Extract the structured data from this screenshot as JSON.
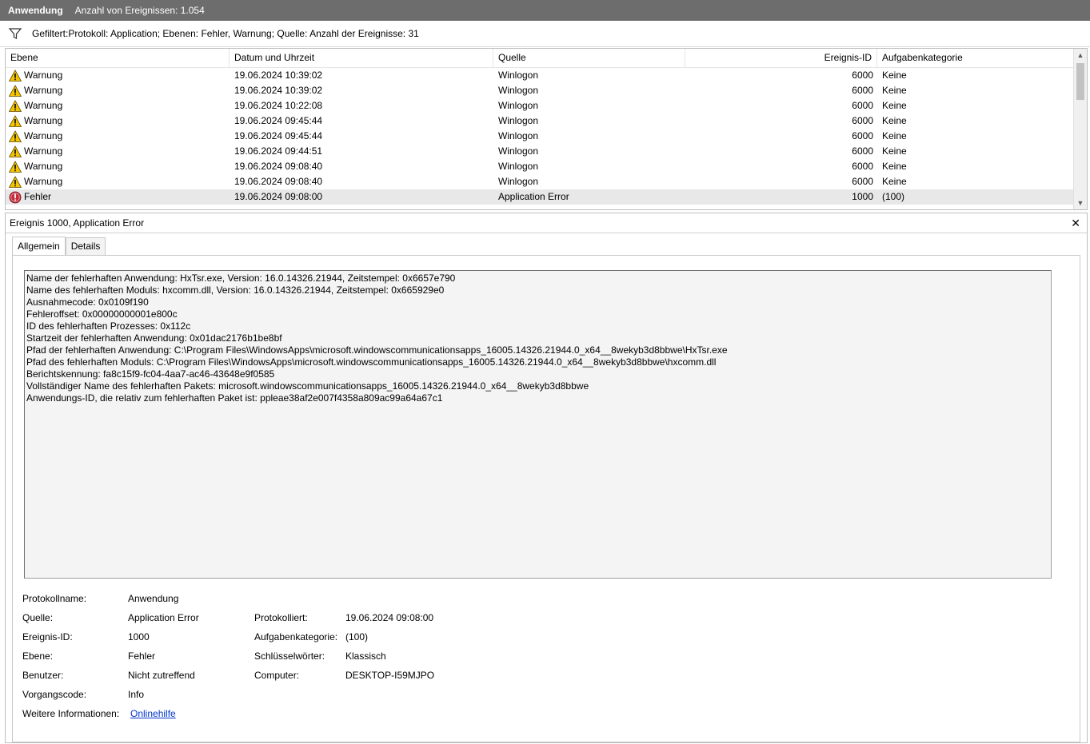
{
  "title": {
    "log_name": "Anwendung",
    "event_count": "Anzahl von Ereignissen: 1.054"
  },
  "filter": {
    "icon": "filter-icon",
    "text": "Gefiltert:Protokoll: Application; Ebenen: Fehler, Warnung; Quelle:  Anzahl der Ereignisse: 31"
  },
  "grid": {
    "columns": [
      "Ebene",
      "Datum und Uhrzeit",
      "Quelle",
      "Ereignis-ID",
      "Aufgabenkategorie"
    ],
    "rows": [
      {
        "level": "Warnung",
        "icon": "warning-icon",
        "datetime": "19.06.2024 10:39:02",
        "source": "Winlogon",
        "id": "6000",
        "category": "Keine"
      },
      {
        "level": "Warnung",
        "icon": "warning-icon",
        "datetime": "19.06.2024 10:39:02",
        "source": "Winlogon",
        "id": "6000",
        "category": "Keine"
      },
      {
        "level": "Warnung",
        "icon": "warning-icon",
        "datetime": "19.06.2024 10:22:08",
        "source": "Winlogon",
        "id": "6000",
        "category": "Keine"
      },
      {
        "level": "Warnung",
        "icon": "warning-icon",
        "datetime": "19.06.2024 09:45:44",
        "source": "Winlogon",
        "id": "6000",
        "category": "Keine"
      },
      {
        "level": "Warnung",
        "icon": "warning-icon",
        "datetime": "19.06.2024 09:45:44",
        "source": "Winlogon",
        "id": "6000",
        "category": "Keine"
      },
      {
        "level": "Warnung",
        "icon": "warning-icon",
        "datetime": "19.06.2024 09:44:51",
        "source": "Winlogon",
        "id": "6000",
        "category": "Keine"
      },
      {
        "level": "Warnung",
        "icon": "warning-icon",
        "datetime": "19.06.2024 09:08:40",
        "source": "Winlogon",
        "id": "6000",
        "category": "Keine"
      },
      {
        "level": "Warnung",
        "icon": "warning-icon",
        "datetime": "19.06.2024 09:08:40",
        "source": "Winlogon",
        "id": "6000",
        "category": "Keine"
      },
      {
        "level": "Fehler",
        "icon": "error-icon",
        "datetime": "19.06.2024 09:08:00",
        "source": "Application Error",
        "id": "1000",
        "category": "(100)"
      }
    ]
  },
  "detail": {
    "title": "Ereignis 1000, Application Error",
    "close_glyph": "✕",
    "tabs": [
      "Allgemein",
      "Details"
    ],
    "message": [
      "Name der fehlerhaften Anwendung: HxTsr.exe, Version: 16.0.14326.21944, Zeitstempel: 0x6657e790",
      "Name des fehlerhaften Moduls: hxcomm.dll, Version: 16.0.14326.21944, Zeitstempel: 0x665929e0",
      "Ausnahmecode: 0x0109f190",
      "Fehleroffset: 0x00000000001e800c",
      "ID des fehlerhaften Prozesses: 0x112c",
      "Startzeit der fehlerhaften Anwendung: 0x01dac2176b1be8bf",
      "Pfad der fehlerhaften Anwendung: C:\\Program Files\\WindowsApps\\microsoft.windowscommunicationsapps_16005.14326.21944.0_x64__8wekyb3d8bbwe\\HxTsr.exe",
      "Pfad des fehlerhaften Moduls: C:\\Program Files\\WindowsApps\\microsoft.windowscommunicationsapps_16005.14326.21944.0_x64__8wekyb3d8bbwe\\hxcomm.dll",
      "Berichtskennung: fa8c15f9-fc04-4aa7-ac46-43648e9f0585",
      "Vollständiger Name des fehlerhaften Pakets: microsoft.windowscommunicationsapps_16005.14326.21944.0_x64__8wekyb3d8bbwe",
      "Anwendungs-ID, die relativ zum fehlerhaften Paket ist: ppleae38af2e007f4358a809ac99a64a67c1"
    ],
    "props": {
      "protokollname_label": "Protokollname:",
      "protokollname": "Anwendung",
      "quelle_label": "Quelle:",
      "quelle": "Application Error",
      "protokolliert_label": "Protokolliert:",
      "protokolliert": "19.06.2024 09:08:00",
      "ereignis_id_label": "Ereignis-ID:",
      "ereignis_id": "1000",
      "aufgabenkategorie_label": "Aufgabenkategorie:",
      "aufgabenkategorie": "(100)",
      "ebene_label": "Ebene:",
      "ebene": "Fehler",
      "schluesselwoerter_label": "Schlüsselwörter:",
      "schluesselwoerter": "Klassisch",
      "benutzer_label": "Benutzer:",
      "benutzer": "Nicht zutreffend",
      "computer_label": "Computer:",
      "computer": "DESKTOP-I59MJPO",
      "vorgangscode_label": "Vorgangscode:",
      "vorgangscode": "Info",
      "weitere_label": "Weitere Informationen:",
      "weitere_link": "Onlinehilfe"
    }
  },
  "colors": {
    "titlebar": "#6d6d6d",
    "selected_row": "#e8e8e8",
    "warning": "#f5c400",
    "error": "#c42b3c",
    "link": "#0033cc"
  }
}
